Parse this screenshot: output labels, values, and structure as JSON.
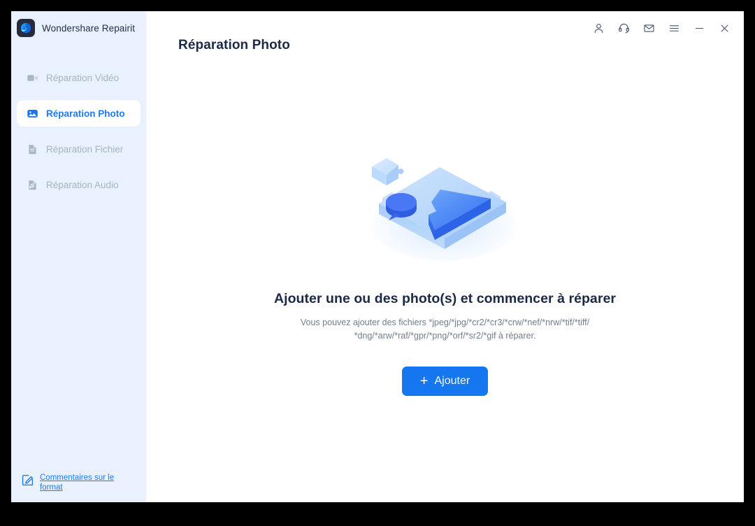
{
  "window": {
    "brand": "Wondershare Repairit",
    "logo_icon": "wondershare-swirl-logo",
    "controls": [
      {
        "name": "account-icon",
        "label": "Account"
      },
      {
        "name": "support-headset-icon",
        "label": "Support"
      },
      {
        "name": "mail-icon",
        "label": "Messages"
      },
      {
        "name": "hamburger-menu-icon",
        "label": "Menu"
      },
      {
        "name": "minimize-icon",
        "label": "Minimize"
      },
      {
        "name": "close-icon",
        "label": "Close"
      }
    ]
  },
  "sidebar": {
    "items": [
      {
        "label": "Réparation Vidéo",
        "icon": "video-camera-icon",
        "active": false
      },
      {
        "label": "Réparation Photo",
        "icon": "photo-image-icon",
        "active": true
      },
      {
        "label": "Réparation Fichier",
        "icon": "document-file-icon",
        "active": false
      },
      {
        "label": "Réparation Audio",
        "icon": "music-note-icon",
        "active": false
      }
    ],
    "feedback": {
      "label": "Commentaires sur le format",
      "icon": "edit-square-icon"
    }
  },
  "main": {
    "page_title": "Réparation Photo",
    "empty_state": {
      "illustration": "isometric-puzzle-photo-slab",
      "title": "Ajouter une ou des photo(s) et commencer à réparer",
      "subtitle_line1": "Vous pouvez ajouter des fichiers *jpeg/*jpg/*cr2/*cr3/*crw/*nef/*nrw/*tif/*tiff/",
      "subtitle_line2": "*dng/*arw/*raf/*gpr/*png/*orf/*sr2/*gif à réparer.",
      "add_button": "Ajouter",
      "add_button_plus": "+"
    }
  },
  "colors": {
    "accent": "#1577f0",
    "sidebar_bg": "#e8f1fd",
    "title_text": "#1b2a46",
    "muted_text": "#a7b2c4",
    "subtitle_text": "#737d8f",
    "frame": "#000000"
  }
}
